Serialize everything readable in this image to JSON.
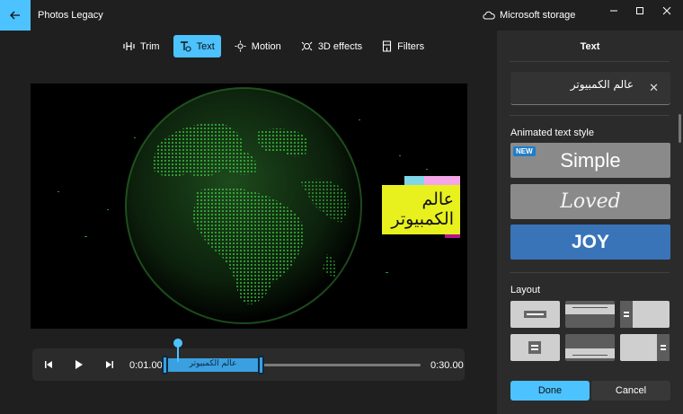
{
  "app": {
    "title": "Photos Legacy",
    "storage_label": "Microsoft storage",
    "accent_color": "#4cc2ff"
  },
  "window_controls": {
    "icons": [
      "minimize-icon",
      "maximize-icon",
      "close-icon"
    ]
  },
  "toolbar": {
    "items": [
      {
        "label": "Trim",
        "icon": "trim-icon",
        "active": false
      },
      {
        "label": "Text",
        "icon": "text-icon",
        "active": true
      },
      {
        "label": "Motion",
        "icon": "motion-icon",
        "active": false
      },
      {
        "label": "3D effects",
        "icon": "3d-effects-icon",
        "active": false
      },
      {
        "label": "Filters",
        "icon": "filters-icon",
        "active": false
      }
    ]
  },
  "preview": {
    "overlay_text_line1": "عالم",
    "overlay_text_line2": "الكمبيوتر",
    "overlay_color": "#e8f01e"
  },
  "timeline": {
    "start_time": "0:01.00",
    "end_time": "0:30.00",
    "clip_label": "عالم الكمبيوتر"
  },
  "panel": {
    "title": "Text",
    "text_value": "عالم الكمبيوتر",
    "clear_glyph": "✕",
    "animated_style_label": "Animated text style",
    "styles": [
      {
        "label": "Simple",
        "badge": "NEW",
        "selected": false
      },
      {
        "label": "Loved",
        "selected": false
      },
      {
        "label": "JOY",
        "selected": true
      }
    ],
    "layout_label": "Layout",
    "done_label": "Done",
    "cancel_label": "Cancel"
  }
}
